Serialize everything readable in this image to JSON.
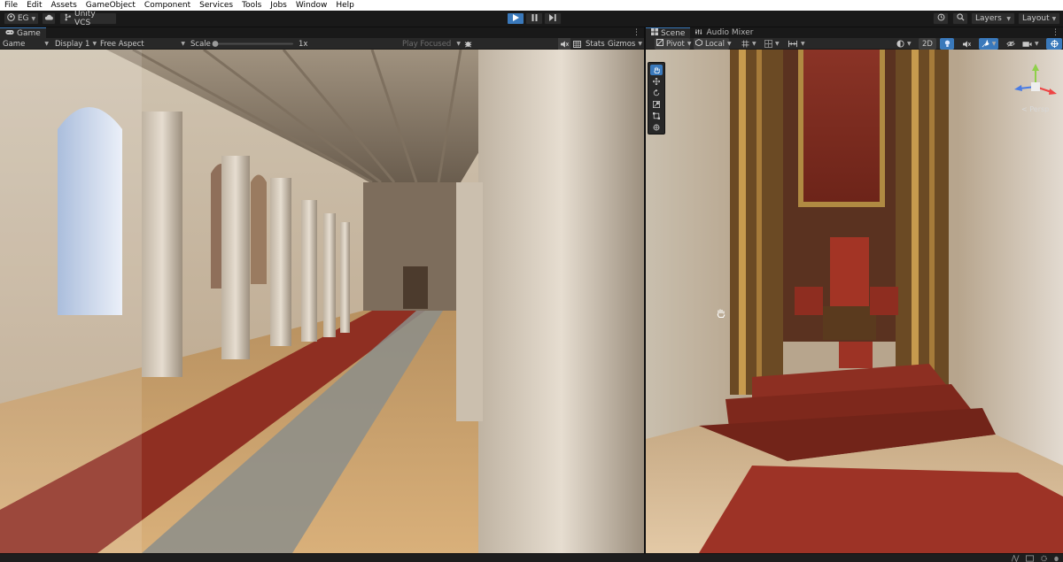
{
  "menu": [
    "File",
    "Edit",
    "Assets",
    "GameObject",
    "Component",
    "Services",
    "Tools",
    "Jobs",
    "Window",
    "Help"
  ],
  "toolbar": {
    "account_label": "EG",
    "vcs_label": "Unity VCS",
    "layers_label": "Layers",
    "layout_label": "Layout"
  },
  "game": {
    "tab_label": "Game",
    "mode_label": "Game",
    "display_label": "Display 1",
    "aspect_label": "Free Aspect",
    "scale_label": "Scale",
    "scale_value": "1x",
    "play_focused_label": "Play Focused",
    "stats_label": "Stats",
    "gizmos_label": "Gizmos"
  },
  "scene": {
    "tab_label": "Scene",
    "audio_tab_label": "Audio Mixer",
    "pivot_label": "Pivot",
    "local_label": "Local",
    "mode_2d_label": "2D",
    "persp_label": "< Persp"
  },
  "colors": {
    "accent": "#3a79bb",
    "panel": "#282828",
    "background": "#191919"
  }
}
